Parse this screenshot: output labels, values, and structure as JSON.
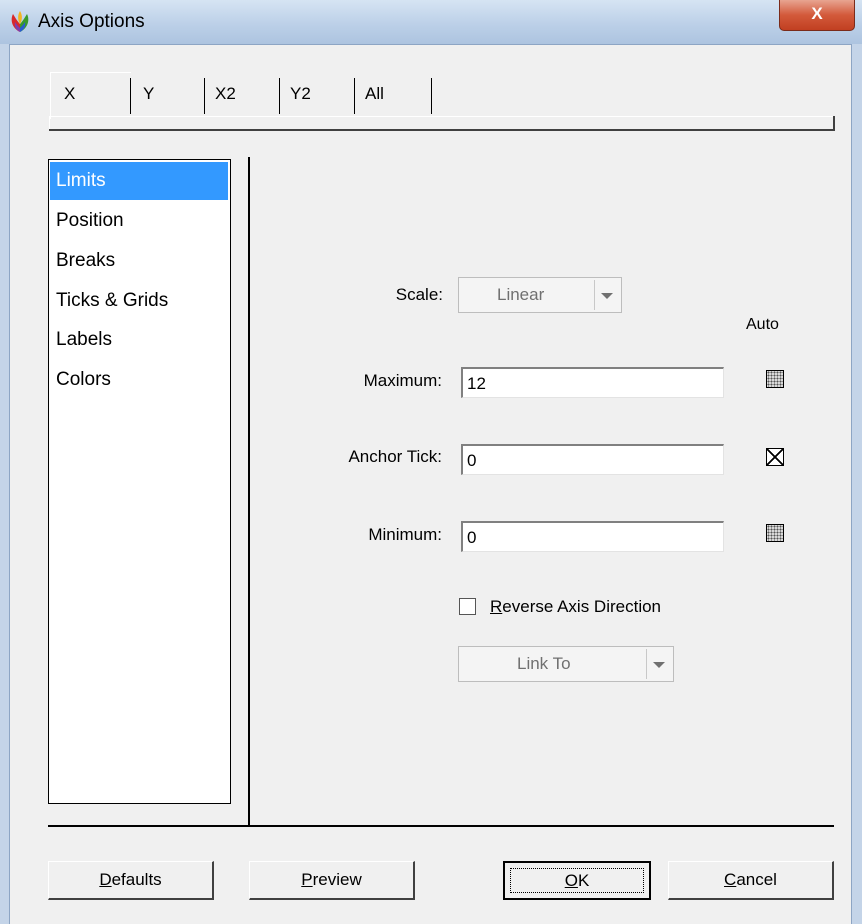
{
  "window": {
    "title": "Axis Options",
    "close_glyph": "X"
  },
  "tabs": [
    {
      "label": "X",
      "selected": true
    },
    {
      "label": "Y",
      "selected": false
    },
    {
      "label": "X2",
      "selected": false
    },
    {
      "label": "Y2",
      "selected": false
    },
    {
      "label": "All",
      "selected": false
    }
  ],
  "sidebar": {
    "items": [
      {
        "label": "Limits",
        "selected": true
      },
      {
        "label": "Position",
        "selected": false
      },
      {
        "label": "Breaks",
        "selected": false
      },
      {
        "label": "Ticks & Grids",
        "selected": false
      },
      {
        "label": "Labels",
        "selected": false
      },
      {
        "label": "Colors",
        "selected": false
      }
    ]
  },
  "form": {
    "scale_label": "Scale:",
    "scale_value": "Linear",
    "auto_header": "Auto",
    "maximum_label": "Maximum:",
    "maximum_value": "12",
    "maximum_auto": "indeterminate",
    "anchor_label": "Anchor Tick:",
    "anchor_value": "0",
    "anchor_auto": "checked",
    "minimum_label": "Minimum:",
    "minimum_value": "0",
    "minimum_auto": "indeterminate",
    "reverse_mnemonic": "R",
    "reverse_rest": "everse Axis Direction",
    "reverse_checked": false,
    "link_to_value": "Link To"
  },
  "buttons": {
    "defaults_mnemonic": "D",
    "defaults_rest": "efaults",
    "preview_mnemonic": "P",
    "preview_rest": "review",
    "ok_mnemonic": "O",
    "ok_rest": "K",
    "cancel_mnemonic": "C",
    "cancel_rest": "ancel"
  },
  "icons": {
    "app": "origin-app-icon",
    "close": "close-icon",
    "dropdown": "chevron-down-icon"
  },
  "colors": {
    "selection": "#3399ff",
    "close_button": "#d35a3b",
    "dialog_bg": "#f0f0f0"
  }
}
